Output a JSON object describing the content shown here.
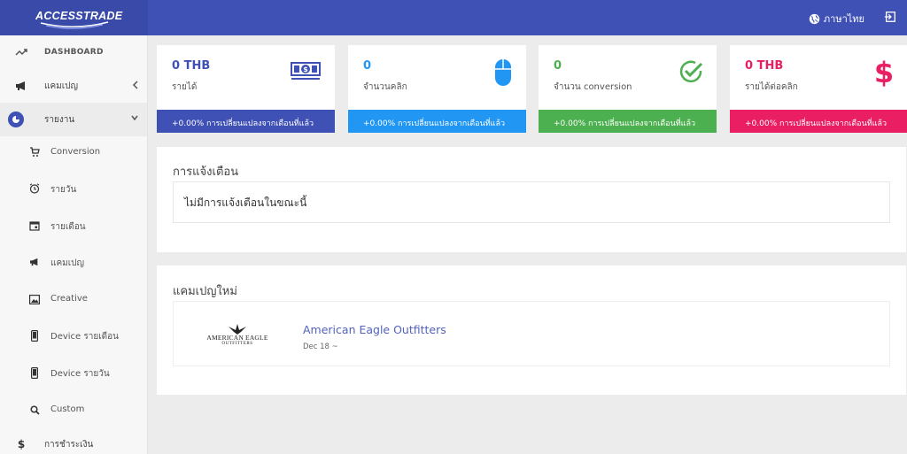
{
  "header": {
    "logo_text": "ACCESSTRADE",
    "language_label": "ภาษาไทย",
    "colors": {
      "bar": "#3f51b5"
    }
  },
  "sidebar": {
    "items": [
      {
        "label": "DASHBOARD",
        "icon": "trending-up-icon"
      },
      {
        "label": "แคมเปญ",
        "icon": "megaphone-icon"
      },
      {
        "label": "รายงาน",
        "icon": "pie-chart-icon"
      }
    ],
    "report_subitems": [
      {
        "label": "Conversion",
        "icon": "cart-icon"
      },
      {
        "label": "รายวัน",
        "icon": "clock-icon"
      },
      {
        "label": "รายเดือน",
        "icon": "calendar-icon"
      },
      {
        "label": "แคมเปญ",
        "icon": "megaphone-icon"
      },
      {
        "label": "Creative",
        "icon": "image-icon"
      },
      {
        "label": "Device รายเดือน",
        "icon": "phone-icon"
      },
      {
        "label": "Device รายวัน",
        "icon": "phone-icon"
      },
      {
        "label": "Custom",
        "icon": "search-icon"
      }
    ],
    "payment": {
      "label": "การชำระเงิน",
      "icon": "dollar-icon"
    }
  },
  "stats": [
    {
      "value": "0 THB",
      "caption": "รายได้",
      "footer": "+0.00% การเปลี่ยนแปลงจากเดือนที่แล้ว",
      "color": "#3f51b5",
      "icon": "money-icon"
    },
    {
      "value": "0",
      "caption": "จำนวนคลิก",
      "footer": "+0.00% การเปลี่ยนแปลงจากเดือนที่แล้ว",
      "color": "#2196f3",
      "icon": "mouse-icon"
    },
    {
      "value": "0",
      "caption": "จำนวน conversion",
      "footer": "+0.00% การเปลี่ยนแปลงจากเดือนที่แล้ว",
      "color": "#4caf50",
      "icon": "check-circle-icon"
    },
    {
      "value": "0 THB",
      "caption": "รายได้ต่อคลิก",
      "footer": "+0.00% การเปลี่ยนแปลงจากเดือนที่แล้ว",
      "color": "#e91e63",
      "icon": "dollar-icon"
    }
  ],
  "notifications": {
    "title": "การแจ้งเตือน",
    "empty_text": "ไม่มีการแจ้งเตือนในขณะนี้"
  },
  "new_campaigns": {
    "title": "แคมเปญใหม่",
    "items": [
      {
        "name": "American Eagle Outfitters",
        "date": "Dec 18 ~",
        "logo_text": "AMERICAN EAGLE",
        "logo_sub": "OUTFITTERS"
      }
    ]
  }
}
